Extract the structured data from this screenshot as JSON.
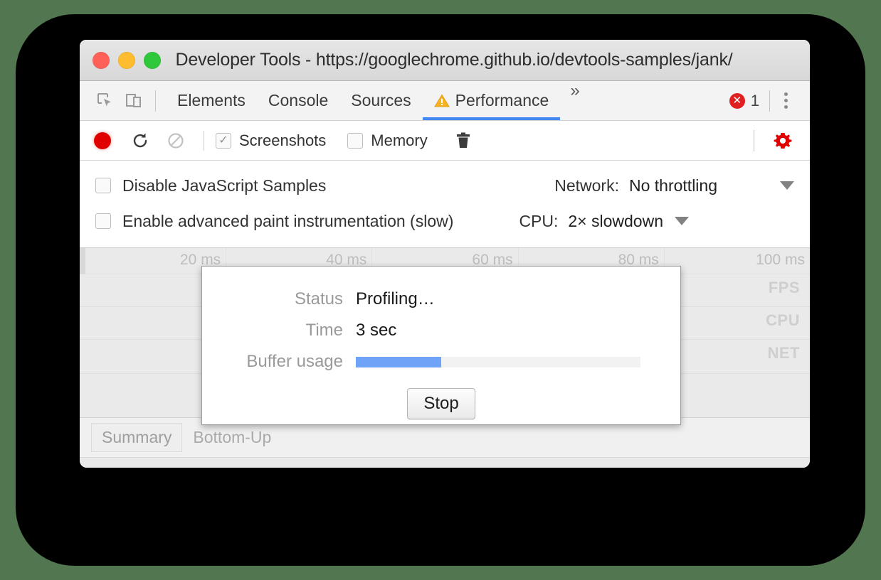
{
  "window": {
    "title": "Developer Tools - https://googlechrome.github.io/devtools-samples/jank/",
    "traffic_lights": [
      "close",
      "minimize",
      "maximize"
    ]
  },
  "tabbar": {
    "inspect_icon": "inspect-cursor-icon",
    "device_icon": "device-toolbar-icon",
    "tabs": [
      {
        "label": "Elements",
        "active": false,
        "warning": false
      },
      {
        "label": "Console",
        "active": false,
        "warning": false
      },
      {
        "label": "Sources",
        "active": false,
        "warning": false
      },
      {
        "label": "Performance",
        "active": true,
        "warning": true
      }
    ],
    "more_label": "»",
    "error_count": "1",
    "error_icon": "error-circle-icon",
    "menu_icon": "kebab-menu-icon",
    "active_underline_color": "#4285f4",
    "warning_icon_color": "#f5a623",
    "error_badge_color": "#e02020"
  },
  "controls": {
    "record_button": "record-circle-icon",
    "record_color": "#e00000",
    "reload_button": "reload-icon",
    "clear_button": "clear-icon",
    "screenshots": {
      "label": "Screenshots",
      "checked": true
    },
    "memory": {
      "label": "Memory",
      "checked": false
    },
    "trash_button": "trash-icon",
    "settings_button": "gear-icon",
    "settings_color": "#e00000"
  },
  "settings": {
    "disable_js_samples": {
      "label": "Disable JavaScript Samples",
      "checked": false
    },
    "advanced_paint": {
      "label": "Enable advanced paint instrumentation (slow)",
      "checked": false
    },
    "network": {
      "label": "Network:",
      "value": "No throttling"
    },
    "cpu": {
      "label": "CPU:",
      "value": "2× slowdown"
    }
  },
  "timeline": {
    "ticks": [
      {
        "label": "20 ms",
        "pos_pct": 20
      },
      {
        "label": "40 ms",
        "pos_pct": 40
      },
      {
        "label": "60 ms",
        "pos_pct": 60
      },
      {
        "label": "80 ms",
        "pos_pct": 80
      },
      {
        "label": "100 ms",
        "pos_pct": 100
      }
    ],
    "tracks": [
      "FPS",
      "CPU",
      "NET"
    ]
  },
  "bottom_tabs": [
    {
      "label": "Summary",
      "selected": true
    },
    {
      "label": "Bottom-Up",
      "selected": false
    }
  ],
  "dialog": {
    "status_label": "Status",
    "status_value": "Profiling…",
    "time_label": "Time",
    "time_value": "3 sec",
    "buffer_label": "Buffer usage",
    "buffer_percent": 30,
    "buffer_fill_color": "#6ea3f7",
    "stop_label": "Stop"
  }
}
